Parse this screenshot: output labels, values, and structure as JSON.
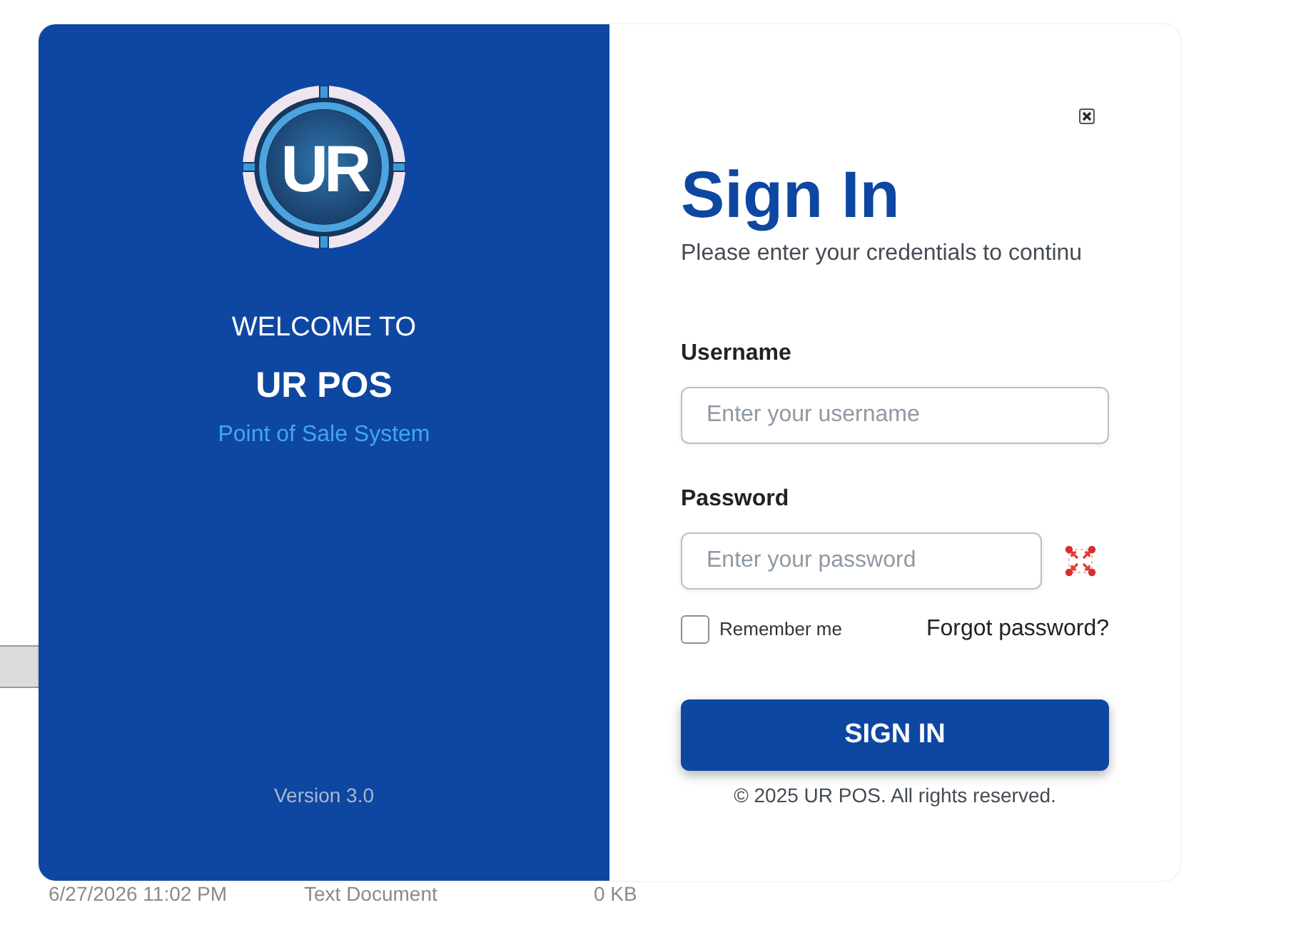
{
  "background_window": {
    "file_row": {
      "cells": [
        "6/27/2026 11:02 PM",
        "Text Document",
        "0 KB"
      ]
    }
  },
  "brand_panel": {
    "logo_text": "UR",
    "welcome": "WELCOME TO",
    "app_name": "UR POS",
    "tagline": "Point of Sale System",
    "version": "Version 3.0"
  },
  "sign_in": {
    "title": "Sign In",
    "subtitle": "Please enter your credentials to continu",
    "fields": [
      {
        "kind": "text",
        "label": "Username",
        "placeholder": "Enter your username"
      },
      {
        "kind": "password",
        "label": "Password",
        "placeholder": "Enter your password"
      }
    ],
    "remember": {
      "label": "Remember me",
      "checked": false
    },
    "forgot_link": "Forgot password?",
    "submit": "SIGN IN",
    "footer": "© 2025 UR POS. All rights reserved."
  }
}
